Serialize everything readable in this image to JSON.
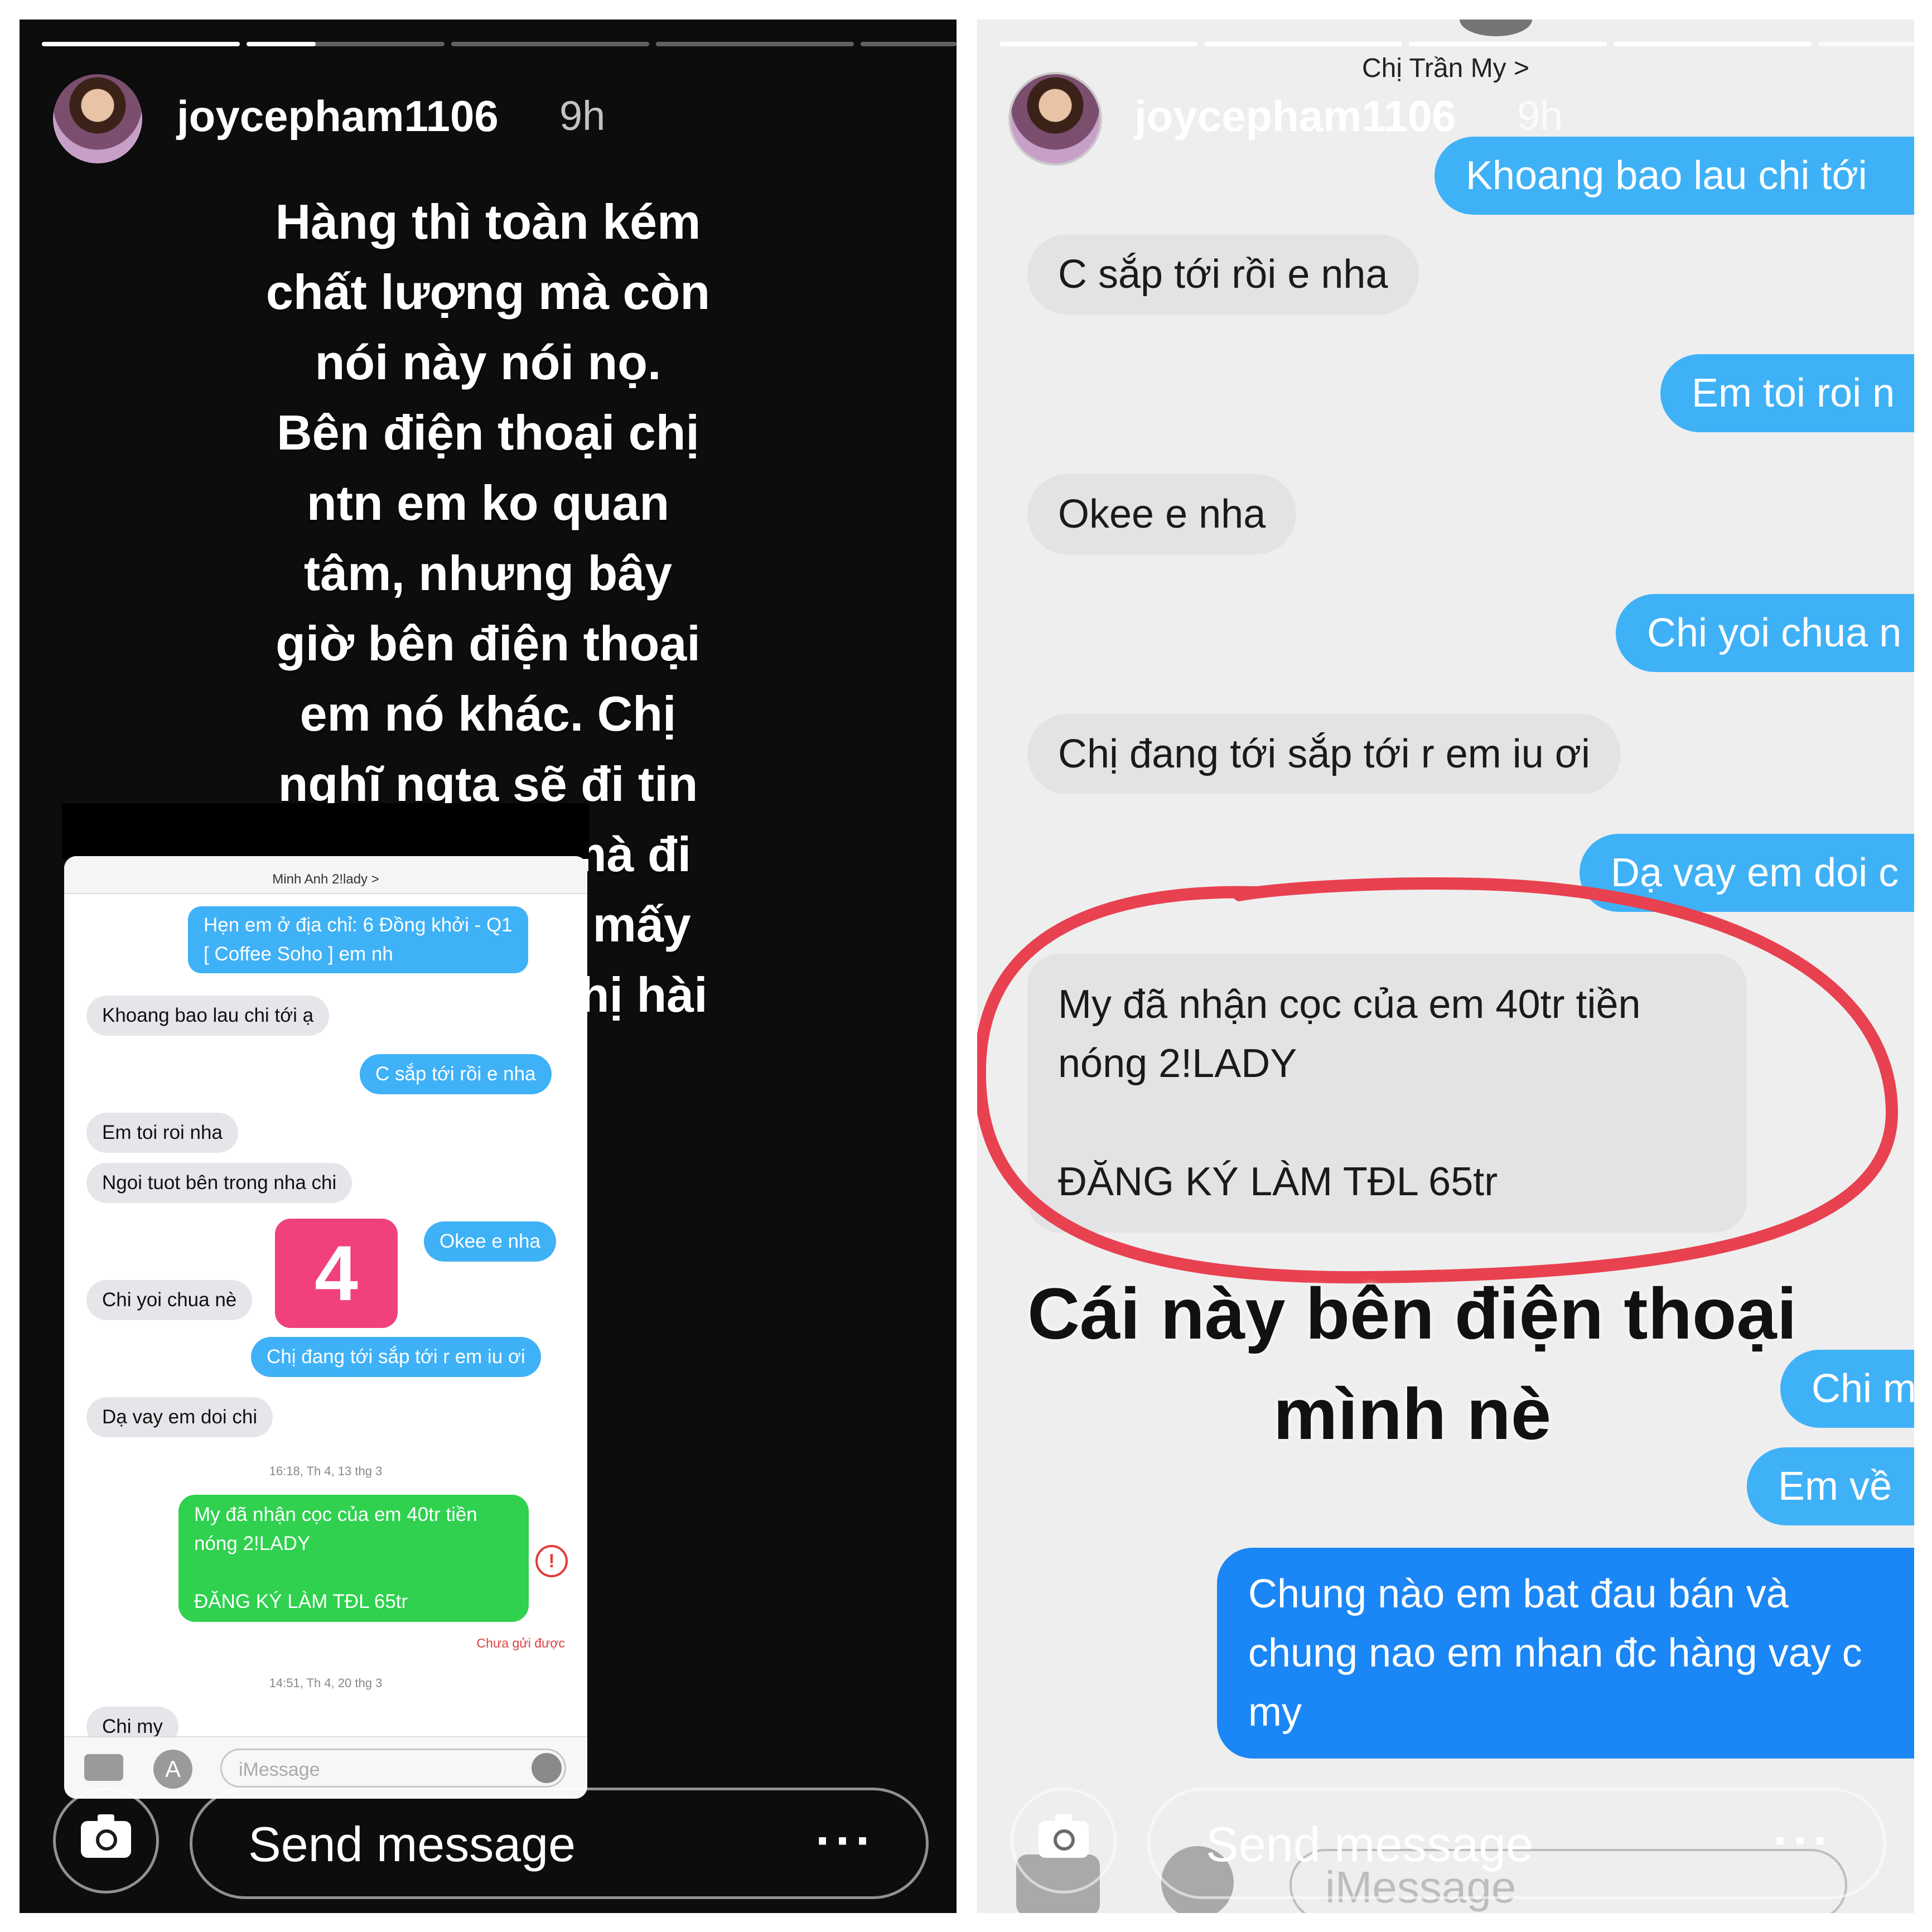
{
  "left_story": {
    "progress": [
      1.0,
      0.35,
      0.0,
      0.0,
      0.0
    ],
    "username": "joycepham1106",
    "time": "9h",
    "caption": "Hàng thì toàn kém chất lượng mà còn nói này nói nọ. Bên điện thoại chị ntn em ko quan tâm, nhưng bây giờ bên điện thoại em nó khác. Chị nghĩ ngta sẽ đi tin một con ng mà đi thiếu nợ 2 tỷ mấy như c hã :)) chị hài quá.",
    "screenshot": {
      "contact": "Minh Anh 2!lady >",
      "messages": [
        {
          "dir": "out",
          "text": "Hẹn em ở địa chỉ: 6 Đồng khởi - Q1\n[ Coffee Soho ] em nh"
        },
        {
          "dir": "in",
          "text": "Khoang bao lau chi tới ạ"
        },
        {
          "dir": "out",
          "text": "C sắp tới rồi e nha"
        },
        {
          "dir": "in",
          "text": "Em toi roi nha"
        },
        {
          "dir": "in",
          "text": "Ngoi tuot bên trong nha chi"
        },
        {
          "dir": "out",
          "text": "Okee e nha"
        },
        {
          "dir": "in",
          "text": "Chi yoi chua nè"
        },
        {
          "dir": "out",
          "text": "Chị đang tới sắp tới r em iu ơi"
        },
        {
          "dir": "in",
          "text": "Dạ vay em doi chi"
        },
        {
          "dir": "sms",
          "text": "My đã nhận cọc của em 40tr tiền\nnóng 2!LADY\n\nĐĂNG KÝ LÀM TĐL 65tr"
        },
        {
          "dir": "in",
          "text": "Chi my"
        }
      ],
      "timestamps": [
        "16:18, Th 4, 13 thg 3",
        "14:51, Th 4, 20 thg 3"
      ],
      "failed_label": "Chưa gửi được",
      "error_icon": "!",
      "badge": "4",
      "input_placeholder": "iMessage",
      "icons": {
        "camera": "camera-icon",
        "appstore": "app-store-icon",
        "mic": "microphone-icon"
      }
    },
    "send_bar": {
      "label": "Send message",
      "more": "···"
    }
  },
  "right_story": {
    "progress": [
      1.0,
      1.0,
      1.0,
      1.0,
      0.0
    ],
    "contact": "Chị Trần My >",
    "username": "joycepham1106",
    "time": "9h",
    "messages": [
      {
        "dir": "out",
        "text": "Khoang bao lau chi tới"
      },
      {
        "dir": "in",
        "text": "C sắp tới rồi e nha"
      },
      {
        "dir": "out",
        "text": "Em toi roi n"
      },
      {
        "dir": "in",
        "text": "Okee e nha"
      },
      {
        "dir": "out",
        "text": "Chi yoi chua n"
      },
      {
        "dir": "in",
        "text": "Chị đang tới sắp tới r em iu ơi"
      },
      {
        "dir": "out",
        "text": "Dạ vay em doi c"
      },
      {
        "dir": "in",
        "text": "My đã nhận cọc của em 40tr tiền\nnóng 2!LADY\n\nĐĂNG KÝ LÀM TĐL 65tr"
      },
      {
        "dir": "out",
        "text": "Chi m"
      },
      {
        "dir": "out",
        "text": "Em về"
      },
      {
        "dir": "out",
        "text": "Chung nào em bat đau bán và\nchung nao em nhan đc hàng vay c\nmy"
      }
    ],
    "overlay_caption": "Cái này bên điện thoại\nmình nè",
    "ghost_placeholder": "iMessage",
    "highlight_color": "#e8414f",
    "send_bar": {
      "label": "Send message",
      "more": "···"
    }
  },
  "colors": {
    "imessage_blue": "#3fb1f7",
    "sms_green": "#2fd14f",
    "story_bg": "#0d0d0d"
  }
}
